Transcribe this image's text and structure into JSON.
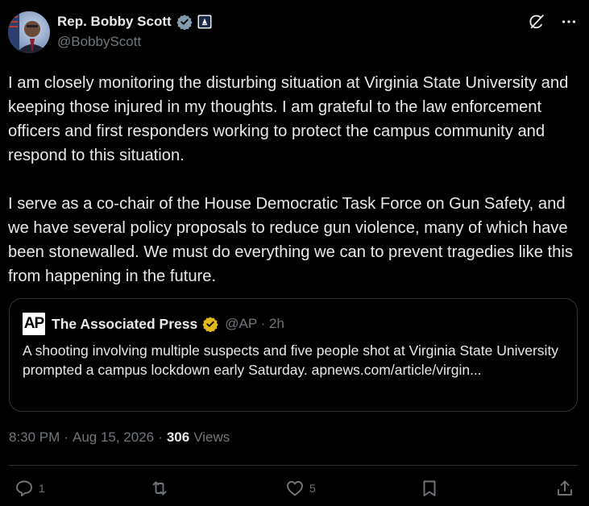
{
  "author": {
    "display_name": "Rep. Bobby Scott",
    "handle": "@BobbyScott",
    "verified_icon": "gray-check-badge-icon",
    "affiliation_icon": "government-seal-badge-icon"
  },
  "top_actions": {
    "grok_icon": "grok-icon",
    "more_icon": "more-horizontal-icon"
  },
  "tweet": {
    "text": "I am closely monitoring the disturbing situation at Virginia State University and keeping those injured in my thoughts. I am grateful to the law enforcement officers and first responders working to protect the campus community and respond to this situation.\n\nI serve as a co-chair of the House Democratic Task Force on Gun Safety, and we have several policy proposals to reduce gun violence, many of which have been stonewalled. We must do everything we can to prevent tragedies like this from happening in the future."
  },
  "quote": {
    "logo_text": "AP",
    "name": "The Associated Press",
    "handle_time": "@AP · 2h",
    "verified_icon": "gold-check-badge-icon",
    "text": "A shooting involving multiple suspects and five people shot at Virginia State University prompted a campus lockdown early Saturday. apnews.com/article/virgin..."
  },
  "meta": {
    "time": "8:30 PM",
    "sep1": "·",
    "date": "Aug 15, 2026",
    "sep2": "·",
    "views_count": "306",
    "views_label": "Views"
  },
  "actions": {
    "reply": {
      "icon": "reply-icon",
      "count": "1"
    },
    "repost": {
      "icon": "repost-icon",
      "count": ""
    },
    "like": {
      "icon": "heart-icon",
      "count": "5"
    },
    "bookmark": {
      "icon": "bookmark-icon"
    },
    "share": {
      "icon": "share-icon"
    }
  },
  "colors": {
    "background": "#000000",
    "text": "#e7e9ea",
    "secondary": "#71767b",
    "border": "#2f3336",
    "gold_badge": "#e2b719"
  }
}
